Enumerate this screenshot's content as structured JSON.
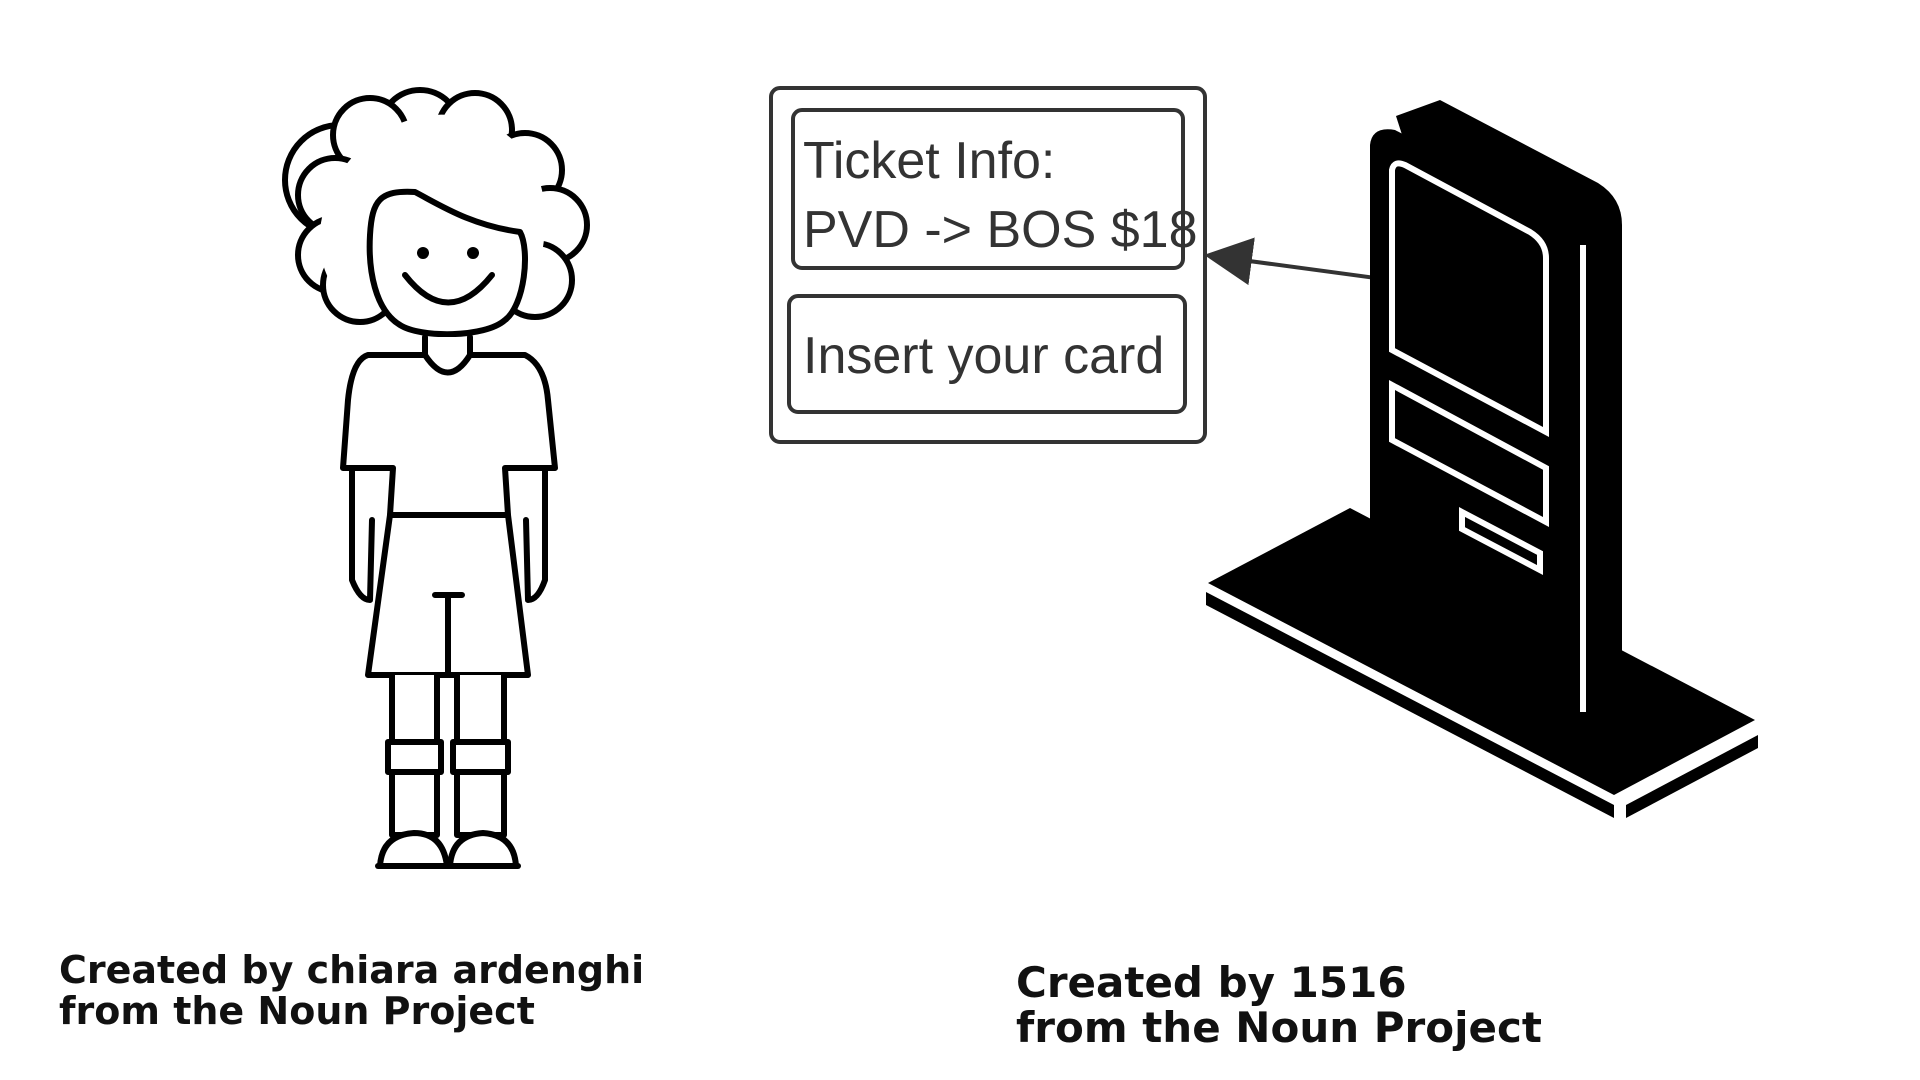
{
  "screen_popup": {
    "ticket_info_line1": "Ticket Info:",
    "ticket_info_line2": "PVD -> BOS $18",
    "action_prompt": "Insert your card"
  },
  "credits": {
    "person": {
      "line1": "Created by chiara ardenghi",
      "line2": "from the Noun Project"
    },
    "kiosk": {
      "line1": "Created by 1516",
      "line2": "from the Noun Project"
    }
  },
  "icons": {
    "person": "person-icon",
    "kiosk": "ticket-kiosk-icon"
  },
  "colors": {
    "ink": "#000000",
    "popup_text": "#333333",
    "background": "#ffffff"
  }
}
